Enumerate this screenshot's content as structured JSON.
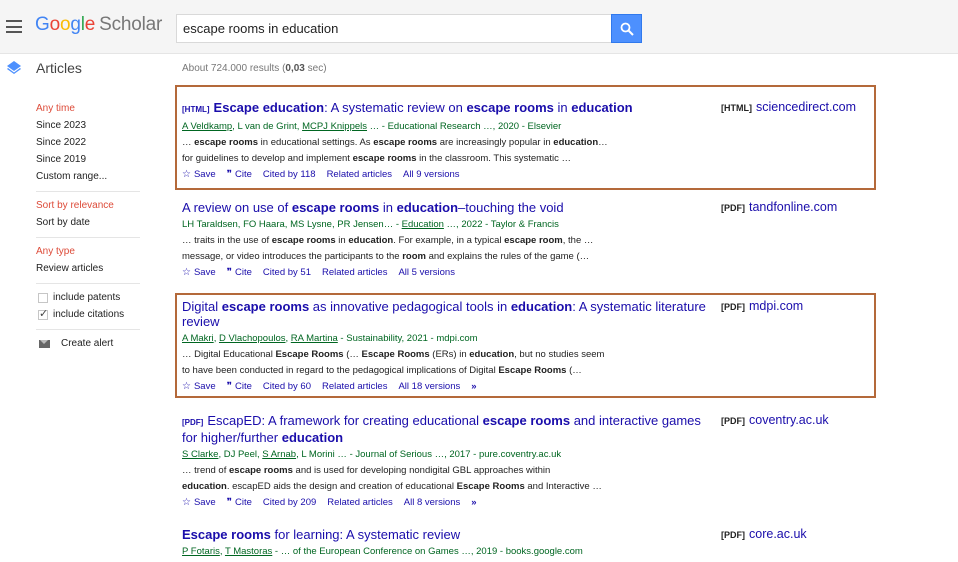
{
  "header": {
    "logo_google": "Google",
    "logo_scholar": "Scholar",
    "search_value": "escape rooms in education"
  },
  "subheader": {
    "articles_label": "Articles",
    "result_count_prefix": "About 724.000 results (",
    "result_count_time": "0,03",
    "result_count_suffix": " sec)"
  },
  "sidebar": {
    "time_filters": [
      "Any time",
      "Since 2023",
      "Since 2022",
      "Since 2019",
      "Custom range..."
    ],
    "sort_options": [
      "Sort by relevance",
      "Sort by date"
    ],
    "type_options": [
      "Any type",
      "Review articles"
    ],
    "checkboxes": [
      {
        "label": "include patents",
        "checked": false
      },
      {
        "label": "include citations",
        "checked": true
      }
    ],
    "create_alert": "Create alert"
  },
  "results": [
    {
      "tag": "[HTML]",
      "title_parts": [
        [
          "Escape education",
          true
        ],
        [
          ": A systematic review on ",
          false
        ],
        [
          "escape rooms",
          true
        ],
        [
          " in ",
          false
        ],
        [
          "education",
          true
        ]
      ],
      "authors_parts": [
        [
          "A Veldkamp",
          true
        ],
        [
          ", L van de Grint, ",
          false
        ],
        [
          "MCPJ Knippels",
          true
        ],
        [
          " … - Educational Research …, 2020 - Elsevier",
          false
        ]
      ],
      "snippet_lines": [
        [
          [
            "… ",
            false
          ],
          [
            "escape rooms",
            true
          ],
          [
            " in educational settings. As ",
            false
          ],
          [
            "escape rooms",
            true
          ],
          [
            " are increasingly popular in ",
            false
          ],
          [
            "education",
            true
          ],
          [
            "…",
            false
          ]
        ],
        [
          [
            "for guidelines to develop and implement ",
            false
          ],
          [
            "escape rooms",
            true
          ],
          [
            " in the classroom. This systematic …",
            false
          ]
        ]
      ],
      "cited_by": "Cited by 118",
      "related": "Related articles",
      "versions": "All 9 versions",
      "side_tag": "[HTML]",
      "side_domain": "sciencedirect.com",
      "highlighted": true,
      "more": false
    },
    {
      "tag": "",
      "title_parts": [
        [
          "A review on use of ",
          false
        ],
        [
          "escape rooms",
          true
        ],
        [
          " in ",
          false
        ],
        [
          "education",
          true
        ],
        [
          "–touching the void",
          false
        ]
      ],
      "authors_parts": [
        [
          "LH Taraldsen, FO Haara, MS Lysne, PR Jensen… - ",
          false
        ],
        [
          "Education",
          true
        ],
        [
          " …, 2022 - Taylor & Francis",
          false
        ]
      ],
      "snippet_lines": [
        [
          [
            "… traits in the use of ",
            false
          ],
          [
            "escape rooms",
            true
          ],
          [
            " in ",
            false
          ],
          [
            "education",
            true
          ],
          [
            ". For example, in a typical ",
            false
          ],
          [
            "escape room",
            true
          ],
          [
            ", the …",
            false
          ]
        ],
        [
          [
            "message, or video introduces the participants to the ",
            false
          ],
          [
            "room",
            true
          ],
          [
            " and explains the rules of the game (…",
            false
          ]
        ]
      ],
      "cited_by": "Cited by 51",
      "related": "Related articles",
      "versions": "All 5 versions",
      "side_tag": "[PDF]",
      "side_domain": "tandfonline.com",
      "highlighted": false,
      "more": false
    },
    {
      "tag": "",
      "title_parts": [
        [
          "Digital ",
          false
        ],
        [
          "escape rooms",
          true
        ],
        [
          " as innovative pedagogical tools in ",
          false
        ],
        [
          "education",
          true
        ],
        [
          ": A systematic literature review",
          false
        ]
      ],
      "authors_parts": [
        [
          "A Makri",
          true
        ],
        [
          ", ",
          false
        ],
        [
          "D Vlachopoulos",
          true
        ],
        [
          ", ",
          false
        ],
        [
          "RA Martina",
          true
        ],
        [
          " - Sustainability, 2021 - mdpi.com",
          false
        ]
      ],
      "snippet_lines": [
        [
          [
            "… Digital Educational ",
            false
          ],
          [
            "Escape Rooms",
            true
          ],
          [
            " (… ",
            false
          ],
          [
            "Escape Rooms",
            true
          ],
          [
            " (ERs) in ",
            false
          ],
          [
            "education",
            true
          ],
          [
            ", but no studies seem",
            false
          ]
        ],
        [
          [
            "to have been conducted in regard to the pedagogical implications of Digital ",
            false
          ],
          [
            "Escape Rooms",
            true
          ],
          [
            " (…",
            false
          ]
        ]
      ],
      "cited_by": "Cited by 60",
      "related": "Related articles",
      "versions": "All 18 versions",
      "side_tag": "[PDF]",
      "side_domain": "mdpi.com",
      "highlighted": true,
      "more": true
    },
    {
      "tag": "[PDF]",
      "title_parts": [
        [
          "EscapED: A framework for creating educational ",
          false
        ],
        [
          "escape rooms",
          true
        ],
        [
          " and interactive games for higher/further ",
          false
        ],
        [
          "education",
          true
        ]
      ],
      "authors_parts": [
        [
          "S Clarke",
          true
        ],
        [
          ", DJ Peel, ",
          false
        ],
        [
          "S Arnab",
          true
        ],
        [
          ", L Morini … - Journal of Serious …, 2017 - pure.coventry.ac.uk",
          false
        ]
      ],
      "snippet_lines": [
        [
          [
            "… trend of ",
            false
          ],
          [
            "escape rooms",
            true
          ],
          [
            " and is used for developing nondigital GBL approaches within",
            false
          ]
        ],
        [
          [
            "education",
            true
          ],
          [
            ". escapED aids the design and creation of educational ",
            false
          ],
          [
            "Escape Rooms",
            true
          ],
          [
            " and Interactive …",
            false
          ]
        ]
      ],
      "cited_by": "Cited by 209",
      "related": "Related articles",
      "versions": "All 8 versions",
      "side_tag": "[PDF]",
      "side_domain": "coventry.ac.uk",
      "highlighted": false,
      "more": true
    },
    {
      "tag": "",
      "title_parts": [
        [
          "Escape rooms",
          true
        ],
        [
          " for learning: A systematic review",
          false
        ]
      ],
      "authors_parts": [
        [
          "P Fotaris",
          true
        ],
        [
          ", ",
          false
        ],
        [
          "T Mastoras",
          true
        ],
        [
          " - … of the European Conference on Games …, 2019 - books.google.com",
          false
        ]
      ],
      "snippet_lines": [],
      "cited_by": "",
      "related": "",
      "versions": "",
      "side_tag": "[PDF]",
      "side_domain": "core.ac.uk",
      "highlighted": false,
      "more": false
    }
  ],
  "actions": {
    "save": "Save",
    "cite": "Cite"
  },
  "colors": {
    "link": "#1a0dab",
    "author_green": "#006621",
    "highlight_frame": "#b4693a",
    "active_red": "#dd4b39",
    "search_blue": "#4d90fe"
  }
}
